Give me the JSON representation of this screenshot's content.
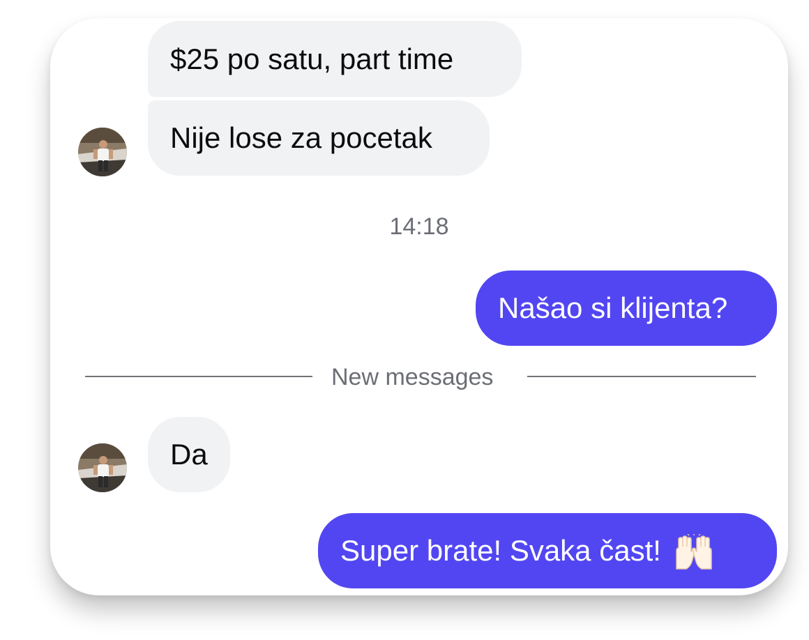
{
  "messages": [
    {
      "text": "$25 po satu, part time",
      "direction": "incoming"
    },
    {
      "text": "Nije lose za pocetak",
      "direction": "incoming"
    },
    {
      "text": "Našao si klijenta?",
      "direction": "outgoing"
    },
    {
      "text": "Da",
      "direction": "incoming"
    },
    {
      "text": "Super brate! Svaka čast!",
      "direction": "outgoing",
      "emoji": "raising-hands-icon"
    }
  ],
  "timestamp": "14:18",
  "divider": {
    "label": "New messages"
  },
  "colors": {
    "incoming_bubble": "#f1f2f4",
    "outgoing_bubble": "#5246f2",
    "meta_text": "#6b6e74"
  }
}
